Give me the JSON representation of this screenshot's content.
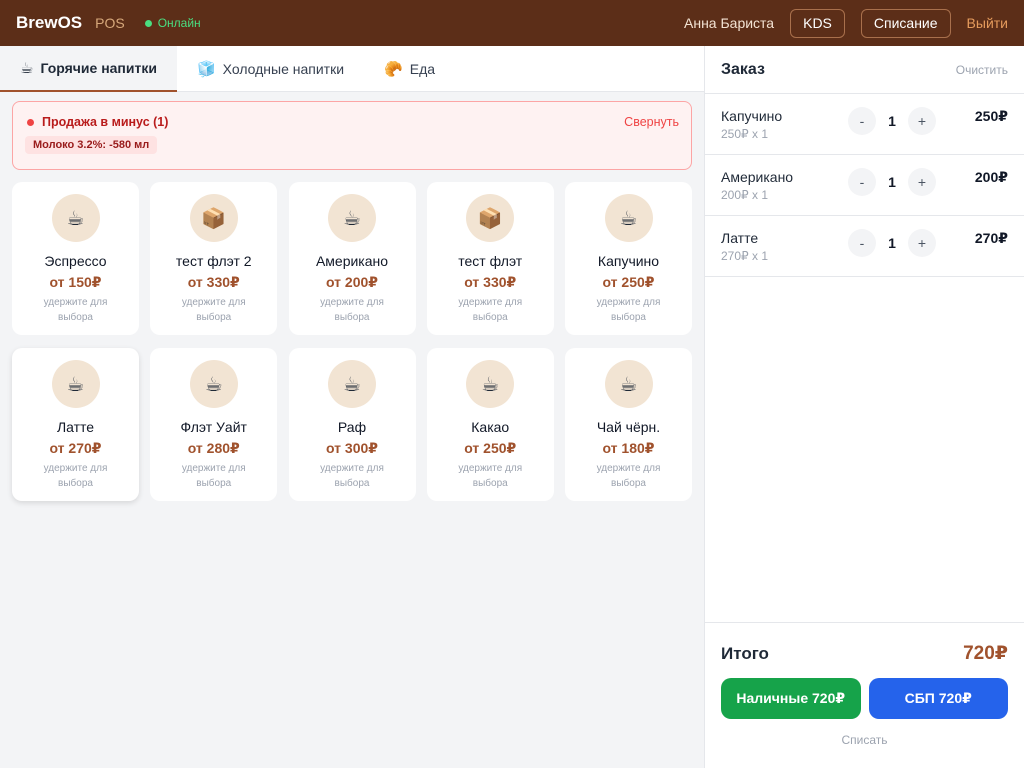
{
  "header": {
    "brand": "BrewOS",
    "pos": "POS",
    "status": "Онлайн",
    "user": "Анна Бариста",
    "kds": "KDS",
    "writeoff": "Списание",
    "logout": "Выйти"
  },
  "tabs": [
    {
      "icon": "☕",
      "icon_name": "coffee-icon",
      "label": "Горячие напитки"
    },
    {
      "icon": "🧊",
      "icon_name": "ice-icon",
      "label": "Холодные напитки"
    },
    {
      "icon": "🥐",
      "icon_name": "croissant-icon",
      "label": "Еда"
    }
  ],
  "alert": {
    "title": "Продажа в минус (1)",
    "collapse": "Свернуть",
    "item": "Молоко 3.2%: -580 мл"
  },
  "products": [
    {
      "icon": "☕",
      "icon_name": "coffee-icon",
      "name": "Эспрессо",
      "price": "от 150₽",
      "hint": "удержите для выбора"
    },
    {
      "icon": "📦",
      "icon_name": "box-icon",
      "name": "тест флэт 2",
      "price": "от 330₽",
      "hint": "удержите для выбора"
    },
    {
      "icon": "☕",
      "icon_name": "coffee-icon",
      "name": "Американо",
      "price": "от 200₽",
      "hint": "удержите для выбора"
    },
    {
      "icon": "📦",
      "icon_name": "box-icon",
      "name": "тест флэт",
      "price": "от 330₽",
      "hint": "удержите для выбора"
    },
    {
      "icon": "☕",
      "icon_name": "coffee-icon",
      "name": "Капучино",
      "price": "от 250₽",
      "hint": "удержите для выбора"
    },
    {
      "icon": "☕",
      "icon_name": "coffee-icon",
      "name": "Латте",
      "price": "от 270₽",
      "hint": "удержите для выбора"
    },
    {
      "icon": "☕",
      "icon_name": "coffee-icon",
      "name": "Флэт Уайт",
      "price": "от 280₽",
      "hint": "удержите для выбора"
    },
    {
      "icon": "☕",
      "icon_name": "coffee-icon",
      "name": "Раф",
      "price": "от 300₽",
      "hint": "удержите для выбора"
    },
    {
      "icon": "☕",
      "icon_name": "coffee-icon",
      "name": "Какао",
      "price": "от 250₽",
      "hint": "удержите для выбора"
    },
    {
      "icon": "☕",
      "icon_name": "coffee-icon",
      "name": "Чай чёрн.",
      "price": "от 180₽",
      "hint": "удержите для выбора"
    }
  ],
  "order": {
    "title": "Заказ",
    "clear": "Очистить",
    "items": [
      {
        "name": "Капучино",
        "sub": "250₽ x 1",
        "minus": "-",
        "qty": "1",
        "plus": "+",
        "total": "250₽"
      },
      {
        "name": "Американо",
        "sub": "200₽ x 1",
        "minus": "-",
        "qty": "1",
        "plus": "+",
        "total": "200₽"
      },
      {
        "name": "Латте",
        "sub": "270₽ x 1",
        "minus": "-",
        "qty": "1",
        "plus": "+",
        "total": "270₽"
      }
    ],
    "total_label": "Итого",
    "total_value": "720₽",
    "cash": "Наличные 720₽",
    "sbp": "СБП 720₽",
    "writeoff": "Списать"
  },
  "colors": {
    "header_bg": "#5c2e18",
    "accent": "#a0522d",
    "cash": "#16a34a",
    "sbp": "#2563eb",
    "online": "#4ade80",
    "alert": "#b91c1c"
  }
}
